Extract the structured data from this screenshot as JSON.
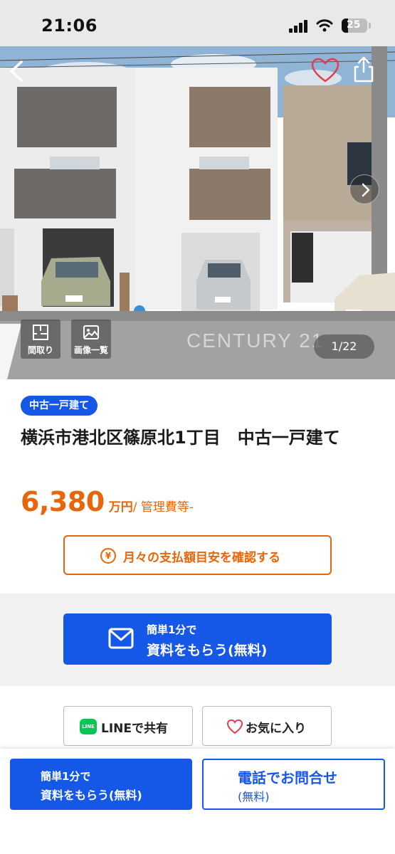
{
  "status_bar": {
    "time": "21:06",
    "battery": "25"
  },
  "gallery": {
    "watermark": "CENTURY 21",
    "floor_plan_label": "間取り",
    "image_list_label": "画像一覧",
    "counter": "1/22"
  },
  "property": {
    "tag": "中古一戸建て",
    "title": "横浜市港北区篠原北1丁目　中古一戸建て",
    "price": "6,380",
    "price_unit": "万円",
    "price_sub": "/ 管理費等-"
  },
  "buttons": {
    "payment_icon": "¥",
    "payment_label": "月々の支払額目安を確認する",
    "request_small": "簡単1分で",
    "request_big": "資料をもらう(無料)",
    "line_logo": "LINE",
    "line_share": "LINEで共有",
    "favorite": "お気に入り"
  },
  "bottom_bar": {
    "request_line1": "簡単1分で",
    "request_line2": "資料をもらう(無料)",
    "tel_line1": "電話でお問合せ",
    "tel_line2": "(無料)"
  },
  "colors": {
    "accent_blue": "#1558e8",
    "accent_orange": "#e8650a",
    "line_green": "#06c755"
  },
  "icons": [
    "back-icon",
    "heart-icon",
    "share-icon",
    "chevron-right-icon",
    "floor-plan-icon",
    "image-list-icon",
    "mail-icon",
    "yen-icon"
  ]
}
